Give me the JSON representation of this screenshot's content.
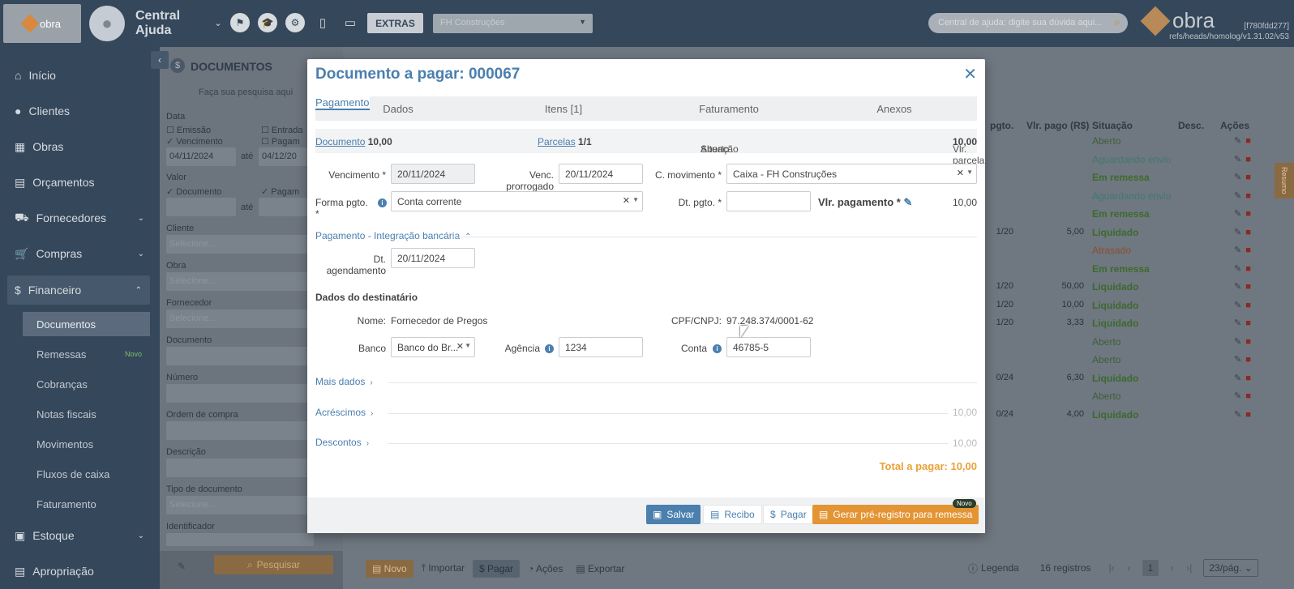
{
  "topbar": {
    "logo_text": "obra",
    "user_line1": "Central",
    "user_line2": "Ajuda",
    "extras_label": "EXTRAS",
    "company_value": "FH Construções",
    "help_placeholder": "Central de ajuda: digite sua dúvida aqui...",
    "brand_text": "obra",
    "version_hash": "[f780fdd277]",
    "version_ref": "refs/heads/homolog/v1.31.02/v53"
  },
  "sidebar": {
    "items": [
      {
        "label": "Início",
        "icon": "home-icon"
      },
      {
        "label": "Clientes",
        "icon": "user-icon"
      },
      {
        "label": "Obras",
        "icon": "building-icon"
      },
      {
        "label": "Orçamentos",
        "icon": "calculator-icon"
      },
      {
        "label": "Fornecedores",
        "icon": "truck-icon"
      },
      {
        "label": "Compras",
        "icon": "cart-icon"
      },
      {
        "label": "Financeiro",
        "icon": "dollar-icon"
      },
      {
        "label": "Estoque",
        "icon": "box-icon"
      },
      {
        "label": "Apropriação",
        "icon": "file-icon"
      }
    ],
    "sub_items": [
      {
        "label": "Documentos"
      },
      {
        "label": "Remessas",
        "badge": "Novo"
      },
      {
        "label": "Cobranças"
      },
      {
        "label": "Notas fiscais"
      },
      {
        "label": "Movimentos"
      },
      {
        "label": "Fluxos de caixa"
      },
      {
        "label": "Faturamento"
      }
    ]
  },
  "filters": {
    "title": "DOCUMENTOS",
    "hint": "Faça sua pesquisa aqui",
    "data_label": "Data",
    "emissao": "Emissão",
    "entrada": "Entrada",
    "vencimento": "Vencimento",
    "pagamento": "Pagam",
    "date_from": "04/11/2024",
    "ate": "até",
    "date_to": "04/12/20",
    "valor_label": "Valor",
    "documento": "Documento",
    "pagamento2": "Pagam",
    "ate2": "até",
    "cliente": "Cliente",
    "obra": "Obra",
    "fornecedor": "Fornecedor",
    "documento_label": "Documento",
    "numero": "Número",
    "ordem": "Ordem de compra",
    "descricao": "Descrição",
    "tipo": "Tipo de documento",
    "identificador": "Identificador",
    "select_placeholder": "Selecione...",
    "search_button": "Pesquisar"
  },
  "table": {
    "headers": {
      "dt_pgto": "pgto.",
      "vlr_pago": "Vlr. pago (R$)",
      "situacao": "Situação",
      "desc": "Desc.",
      "acoes": "Ações"
    },
    "rows": [
      {
        "dt": "",
        "vlr": "",
        "sit": "Aberto",
        "cls": "a"
      },
      {
        "dt": "",
        "vlr": "",
        "sit": "Aguardando envio",
        "cls": "g"
      },
      {
        "dt": "",
        "vlr": "",
        "sit": "Em remessa",
        "cls": "e"
      },
      {
        "dt": "",
        "vlr": "",
        "sit": "Aguardando envio",
        "cls": "g"
      },
      {
        "dt": "",
        "vlr": "",
        "sit": "Em remessa",
        "cls": "e"
      },
      {
        "dt": "1/20",
        "vlr": "5,00",
        "sit": "Liquidado",
        "cls": "l"
      },
      {
        "dt": "",
        "vlr": "",
        "sit": "Atrasado",
        "cls": "t"
      },
      {
        "dt": "",
        "vlr": "",
        "sit": "Em remessa",
        "cls": "e"
      },
      {
        "dt": "1/20",
        "vlr": "50,00",
        "sit": "Liquidado",
        "cls": "l"
      },
      {
        "dt": "1/20",
        "vlr": "10,00",
        "sit": "Liquidado",
        "cls": "l"
      },
      {
        "dt": "1/20",
        "vlr": "3,33",
        "sit": "Liquidado",
        "cls": "l"
      },
      {
        "dt": "",
        "vlr": "",
        "sit": "Aberto",
        "cls": "a"
      },
      {
        "dt": "",
        "vlr": "",
        "sit": "Aberto",
        "cls": "a"
      },
      {
        "dt": "0/24",
        "vlr": "6,30",
        "sit": "Liquidado",
        "cls": "l"
      },
      {
        "dt": "",
        "vlr": "",
        "sit": "Aberto",
        "cls": "a"
      },
      {
        "dt": "0/24",
        "vlr": "4,00",
        "sit": "Liquidado",
        "cls": "l"
      }
    ],
    "side_tab": "Resumo"
  },
  "bottombar": {
    "novo": "Novo",
    "importar": "Importar",
    "pagar": "Pagar",
    "acoes": "Ações",
    "exportar": "Exportar",
    "legenda": "Legenda",
    "registros": "16 registros",
    "page": "1",
    "per_page": "23/pág."
  },
  "modal": {
    "title": "Documento a pagar: 000067",
    "tabs": [
      "Dados",
      "Itens [1]",
      "Pagamento",
      "Faturamento",
      "Anexos"
    ],
    "info": {
      "documento_link": "Documento",
      "documento_value": "10,00",
      "parcelas_link": "Parcelas",
      "parcelas_value": "1/1",
      "situacao_label": "Situação",
      "situacao_value": "Aberto",
      "vlr_parcela_label": "Vlr. parcela",
      "vlr_parcela_value": "10,00"
    },
    "form": {
      "vencimento_label": "Vencimento *",
      "vencimento_value": "20/11/2024",
      "venc_prorrogado_label": "Venc. prorrogado",
      "venc_prorrogado_value": "20/11/2024",
      "c_movimento_label": "C. movimento *",
      "c_movimento_value": "Caixa - FH Construções",
      "forma_pgto_label": "Forma pgto. *",
      "forma_pgto_value": "Conta corrente",
      "dt_pgto_label": "Dt. pgto. *",
      "dt_pgto_value": "",
      "vlr_pagamento_label": "Vlr. pagamento *",
      "vlr_pagamento_value": "10,00"
    },
    "integracao": {
      "title": "Pagamento - Integração bancária",
      "dt_agendamento_label": "Dt. agendamento",
      "dt_agendamento_value": "20/11/2024",
      "destinatario_title": "Dados do destinatário",
      "nome_label": "Nome:",
      "nome_value": "Fornecedor de Pregos",
      "cpf_label": "CPF/CNPJ:",
      "cpf_value": "97.248.374/0001-62",
      "banco_label": "Banco",
      "banco_value": "Banco do Br...",
      "agencia_label": "Agência",
      "agencia_value": "1234",
      "conta_label": "Conta",
      "conta_value": "46785-5"
    },
    "sections": {
      "mais_dados": "Mais dados",
      "acrescimos": "Acréscimos",
      "acrescimos_value": "10,00",
      "descontos": "Descontos",
      "descontos_value": "10,00"
    },
    "total": "Total a pagar: 10,00",
    "buttons": {
      "salvar": "Salvar",
      "recibo": "Recibo",
      "pagar": "Pagar",
      "gerar": "Gerar pré-registro para remessa",
      "novo_badge": "Novo"
    }
  }
}
